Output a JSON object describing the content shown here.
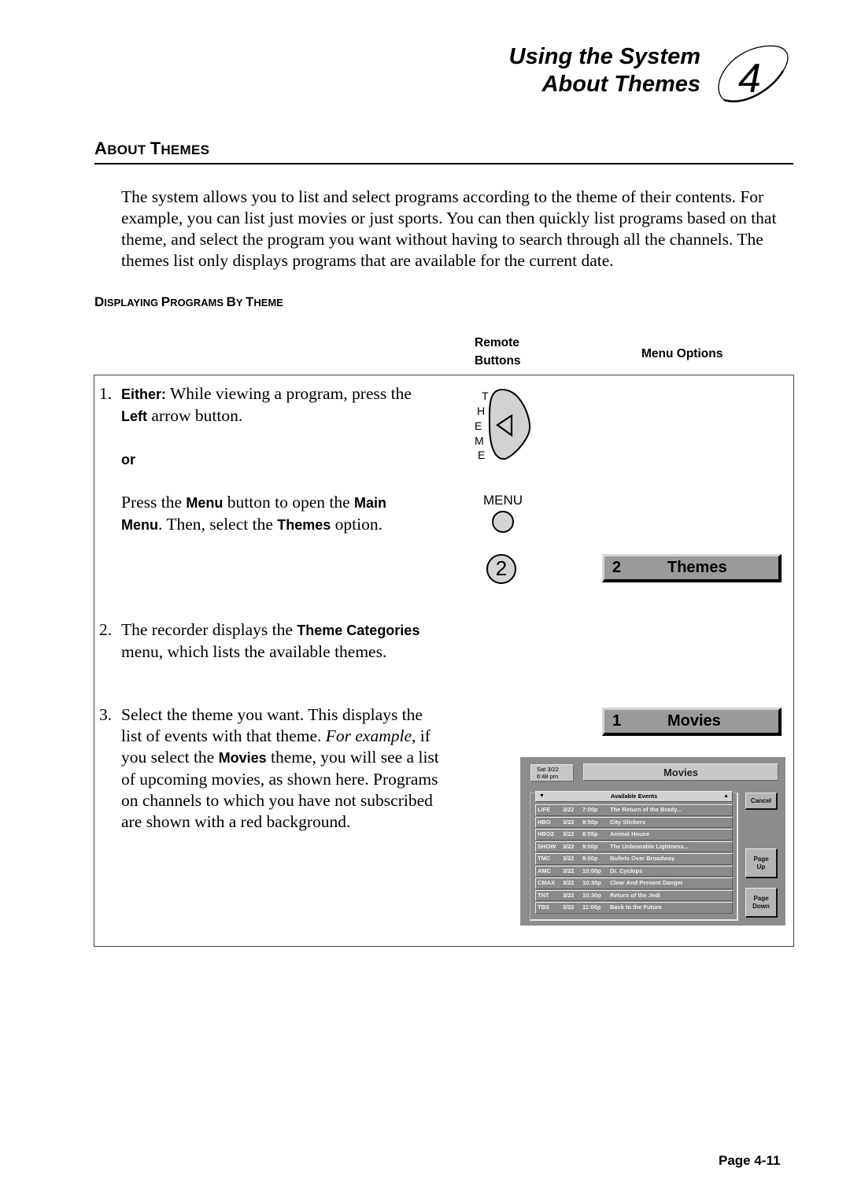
{
  "header": {
    "line1": "Using the System",
    "line2": "About Themes",
    "chapter_number": "4"
  },
  "section": {
    "heading_first": "A",
    "heading_first_rest": "BOUT ",
    "heading_second": "T",
    "heading_second_rest": "HEMES",
    "intro": "The system allows you to list and select programs according to the theme of their contents. For example, you can list just movies or just sports.  You can then quickly list programs based on that theme, and select the program you want without having to search through all the channels. The themes list only displays programs that are available for the current date."
  },
  "subsection": {
    "w1a": "D",
    "w1b": "ISPLAYING ",
    "w2a": "P",
    "w2b": "ROGRAMS ",
    "w3a": "B",
    "w3b": "Y ",
    "w4a": "T",
    "w4b": "HEME"
  },
  "columns": {
    "remote_line1": "Remote",
    "remote_line2": "Buttons",
    "menu_options": "Menu Options"
  },
  "steps": {
    "s1": {
      "num": "1.",
      "either": "Either:",
      "a1": "  While viewing a program, press the",
      "left": "Left",
      "a2": " arrow button.",
      "or": "or",
      "b1": "Press the ",
      "menu": "Menu",
      "b2": " button to open the ",
      "main": "Main",
      "menu2": "Menu",
      "b3": ".   Then, select the ",
      "themes": "Themes",
      "b4": " option."
    },
    "s2": {
      "num": "2.",
      "a1": "The recorder displays the ",
      "bold": "Theme Categories",
      "a2": "menu, which lists the available themes."
    },
    "s3": {
      "num": "3.",
      "l1": "Select the theme you want.  This displays the",
      "l2a": "list of events with that theme.  ",
      "l2i": "For example",
      "l2b": ", if",
      "l3a": "you select the ",
      "l3b": "Movies",
      "l3c": " theme, you will see a list",
      "l4": "of upcoming movies, as shown here.  Programs",
      "l5": "on channels to which you have not subscribed",
      "l6": "are shown with a red background."
    }
  },
  "remote": {
    "theme_letters": [
      "T",
      "H",
      "E",
      "M",
      "E"
    ],
    "menu_label": "MENU",
    "number_button": "2"
  },
  "menu_options": [
    {
      "number": "2",
      "label": "Themes"
    },
    {
      "number": "1",
      "label": "Movies"
    }
  ],
  "tv_screen": {
    "date_line1": "Sat 3/22",
    "date_line2": "6:48 pm",
    "title": "Movies",
    "list_header": "Available Events",
    "scroll_down_icon": "▼",
    "scroll_up_icon": "▲",
    "events": [
      {
        "channel": "LIFE",
        "date": "3/22",
        "time": "7:00p",
        "title": "The Return of the Brady..."
      },
      {
        "channel": "HBO",
        "date": "3/22",
        "time": "8:50p",
        "title": "City Slickers"
      },
      {
        "channel": "HBO2",
        "date": "3/22",
        "time": "8:55p",
        "title": "Animal House"
      },
      {
        "channel": "SHOW",
        "date": "3/22",
        "time": "9:00p",
        "title": "The Unbearable Lightness..."
      },
      {
        "channel": "TMC",
        "date": "3/22",
        "time": "9:00p",
        "title": "Bullets Over Broadway"
      },
      {
        "channel": "AMC",
        "date": "3/22",
        "time": "10:00p",
        "title": "Dr. Cyclops"
      },
      {
        "channel": "CMAX",
        "date": "3/22",
        "time": "10:30p",
        "title": "Clear And Present Danger"
      },
      {
        "channel": "TNT",
        "date": "3/22",
        "time": "10:30p",
        "title": "Return of the Jedi"
      },
      {
        "channel": "TBS",
        "date": "3/22",
        "time": "11:00p",
        "title": "Back to the Future"
      }
    ],
    "cancel_label": "Cancel",
    "page_up_line1": "Page",
    "page_up_line2": "Up",
    "page_down_line1": "Page",
    "page_down_line2": "Down"
  },
  "footer": {
    "page": "Page 4-11"
  }
}
